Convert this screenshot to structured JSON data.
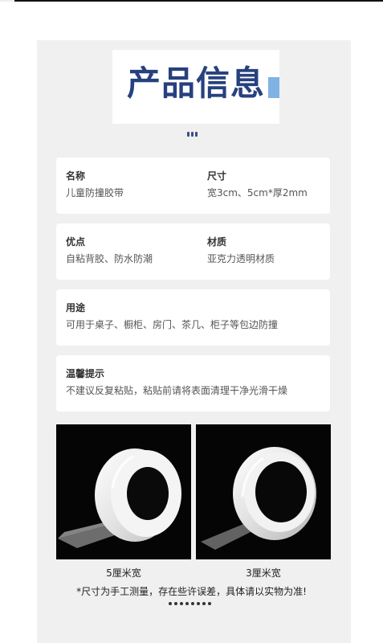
{
  "header": {
    "title": "产品信息"
  },
  "cards": [
    {
      "left": {
        "label": "名称",
        "value": "儿童防撞胶带"
      },
      "right": {
        "label": "尺寸",
        "value": "宽3cm、5cm*厚2mm"
      }
    },
    {
      "left": {
        "label": "优点",
        "value": "自粘背胶、防水防潮"
      },
      "right": {
        "label": "材质",
        "value": "亚克力透明材质"
      }
    },
    {
      "left": {
        "label": "用途",
        "value": "可用于桌子、橱柜、房门、茶几、柜子等包边防撞"
      }
    },
    {
      "left": {
        "label": "温馨提示",
        "value": "不建议反复粘贴，粘贴前请将表面清理干净光滑干燥"
      }
    }
  ],
  "products": [
    {
      "caption": "5厘米宽"
    },
    {
      "caption": "3厘米宽"
    }
  ],
  "note": "*尺寸为手工测量，存在些许误差，具体请以实物为准!"
}
